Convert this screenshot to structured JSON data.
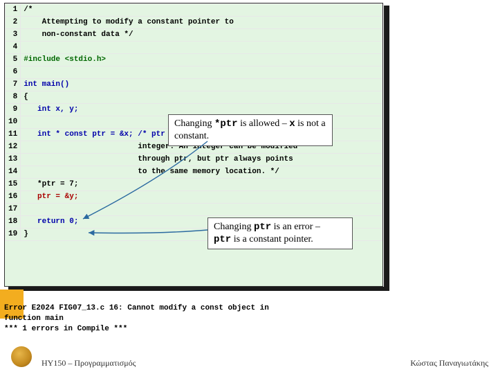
{
  "code": {
    "lines": [
      {
        "n": "1",
        "pre": "",
        "t": "/*"
      },
      {
        "n": "2",
        "pre": "    ",
        "t": "Attempting to modify a constant pointer to"
      },
      {
        "n": "3",
        "pre": "    ",
        "t": "non-constant data */"
      },
      {
        "n": "4",
        "pre": "",
        "t": ""
      },
      {
        "n": "5",
        "pre": "",
        "t": "#include <stdio.h>",
        "cls": "kw-green"
      },
      {
        "n": "6",
        "pre": "",
        "t": ""
      },
      {
        "n": "7",
        "pre": "",
        "t": "int main()",
        "cls": "kw-blue"
      },
      {
        "n": "8",
        "pre": "",
        "t": "{"
      },
      {
        "n": "9",
        "pre": "   ",
        "t": "int x, y;",
        "cls": "kw-blue"
      },
      {
        "n": "10",
        "pre": "",
        "t": ""
      },
      {
        "n": "11",
        "pre": "   ",
        "t": "int * const ptr = &x; /* ptr is a constant pointer to an",
        "cls": "kw-blue"
      },
      {
        "n": "12",
        "pre": "                         ",
        "t": "integer. An integer can be modified"
      },
      {
        "n": "13",
        "pre": "                         ",
        "t": "through ptr, but ptr always points"
      },
      {
        "n": "14",
        "pre": "                         ",
        "t": "to the same memory location. */"
      },
      {
        "n": "15",
        "pre": "   ",
        "t": "*ptr = 7;"
      },
      {
        "n": "16",
        "pre": "   ",
        "t": "ptr = &y;",
        "cls": "warn-red"
      },
      {
        "n": "17",
        "pre": "",
        "t": ""
      },
      {
        "n": "18",
        "pre": "   ",
        "t": "return 0;",
        "cls": "kw-blue"
      },
      {
        "n": "19",
        "pre": "",
        "t": "}"
      }
    ]
  },
  "callout1": {
    "part1": "Changing ",
    "code1": "*ptr",
    "part2": " is allowed – ",
    "code2": "x",
    "part3": " is not a constant."
  },
  "callout2": {
    "part1": "Changing ",
    "code1": "ptr",
    "part2": " is an error – ",
    "code2": "ptr",
    "part3": " is a constant pointer."
  },
  "error": {
    "line1": "Error E2024 FIG07_13.c 16: Cannot modify a const object in",
    "line2": "function main",
    "line3": "*** 1 errors in Compile ***"
  },
  "footer": {
    "left": "ΗΥ150 – Προγραμματισμός",
    "right": "Κώστας Παναγιωτάκης"
  }
}
